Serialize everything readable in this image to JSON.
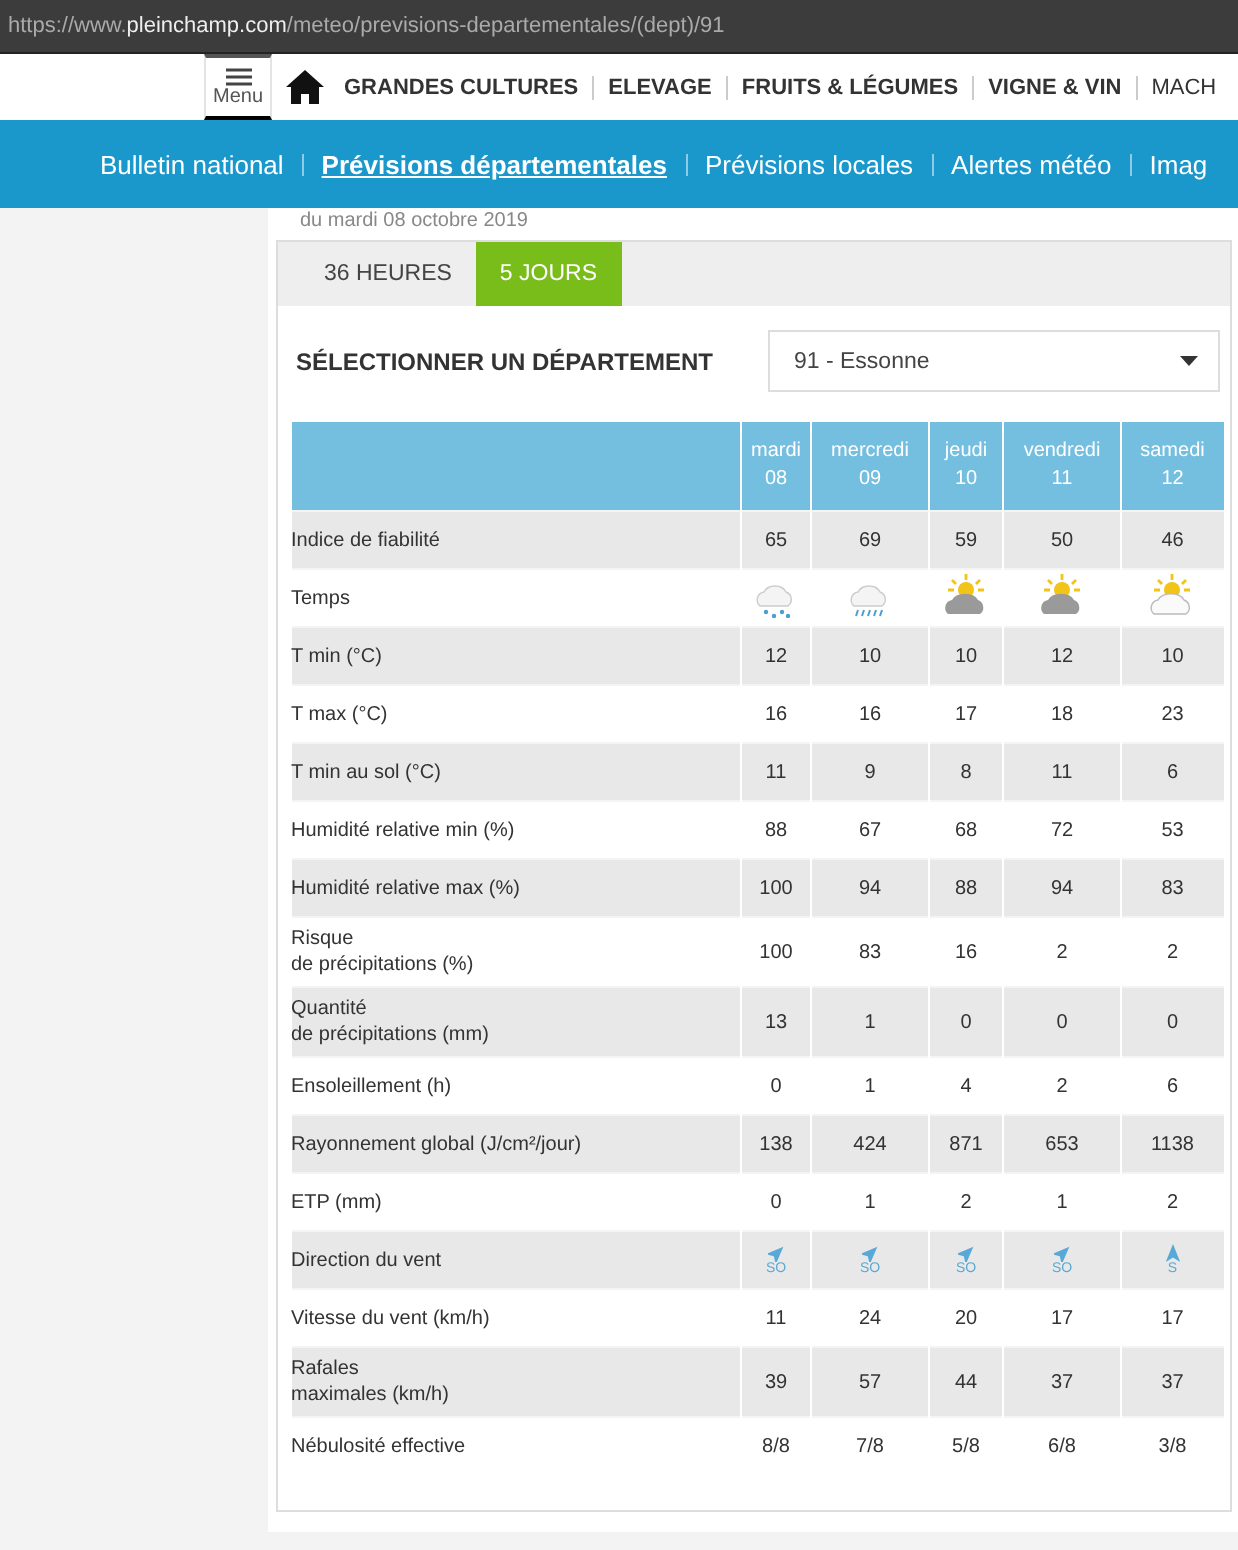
{
  "address_bar": {
    "prefix": "https://www.",
    "domain": "pleinchamp.com",
    "path": "/meteo/previsions-departementales/(dept)/91"
  },
  "menu_button": {
    "label": "Menu"
  },
  "main_nav": [
    {
      "label": "GRANDES CULTURES"
    },
    {
      "label": "ELEVAGE"
    },
    {
      "label": "FRUITS & LÉGUMES"
    },
    {
      "label": "VIGNE & VIN"
    },
    {
      "label": "MACH"
    }
  ],
  "sub_nav": [
    {
      "label": "Bulletin national",
      "selected": false
    },
    {
      "label": "Prévisions départementales",
      "selected": true
    },
    {
      "label": "Prévisions locales",
      "selected": false
    },
    {
      "label": "Alertes météo",
      "selected": false
    },
    {
      "label": "Imag",
      "selected": false
    }
  ],
  "date_line": "du mardi 08 octobre 2019",
  "tabs": [
    {
      "label": "36 HEURES",
      "selected": false
    },
    {
      "label": "5 JOURS",
      "selected": true
    }
  ],
  "department": {
    "label": "SÉLECTIONNER UN DÉPARTEMENT",
    "value": "91 - Essonne"
  },
  "table": {
    "columns": [
      {
        "day": "mardi",
        "date": "08"
      },
      {
        "day": "mercredi",
        "date": "09"
      },
      {
        "day": "jeudi",
        "date": "10"
      },
      {
        "day": "vendredi",
        "date": "11"
      },
      {
        "day": "samedi",
        "date": "12"
      }
    ],
    "rows": [
      {
        "kind": "text",
        "label": "Indice de fiabilité",
        "values": [
          "65",
          "69",
          "59",
          "50",
          "46"
        ]
      },
      {
        "kind": "weather",
        "label": "Temps",
        "values": [
          {
            "kind": "rain"
          },
          {
            "kind": "showers"
          },
          {
            "kind": "sun-dark-cloud"
          },
          {
            "kind": "sun-dark-cloud"
          },
          {
            "kind": "sun-light-cloud"
          }
        ]
      },
      {
        "kind": "text",
        "label": "T min (°C)",
        "values": [
          "12",
          "10",
          "10",
          "12",
          "10"
        ]
      },
      {
        "kind": "text",
        "label": "T max (°C)",
        "values": [
          "16",
          "16",
          "17",
          "18",
          "23"
        ]
      },
      {
        "kind": "text",
        "label": "T min au sol (°C)",
        "values": [
          "11",
          "9",
          "8",
          "11",
          "6"
        ]
      },
      {
        "kind": "text",
        "label": "Humidité relative min (%)",
        "values": [
          "88",
          "67",
          "68",
          "72",
          "53"
        ]
      },
      {
        "kind": "text",
        "label": "Humidité relative max (%)",
        "values": [
          "100",
          "94",
          "88",
          "94",
          "83"
        ]
      },
      {
        "kind": "text",
        "label": "Risque\nde précipitations (%)",
        "values": [
          "100",
          "83",
          "16",
          "2",
          "2"
        ]
      },
      {
        "kind": "text",
        "label": "Quantité\nde précipitations (mm)",
        "values": [
          "13",
          "1",
          "0",
          "0",
          "0"
        ]
      },
      {
        "kind": "text",
        "label": "Ensoleillement (h)",
        "values": [
          "0",
          "1",
          "4",
          "2",
          "6"
        ]
      },
      {
        "kind": "text",
        "label": "Rayonnement global (J/cm²/jour)",
        "values": [
          "138",
          "424",
          "871",
          "653",
          "1138"
        ]
      },
      {
        "kind": "text",
        "label": "ETP (mm)",
        "values": [
          "0",
          "1",
          "2",
          "1",
          "2"
        ]
      },
      {
        "kind": "wind",
        "label": "Direction du vent",
        "values": [
          {
            "kind": "northeast",
            "text": "SO"
          },
          {
            "kind": "northeast",
            "text": "SO"
          },
          {
            "kind": "northeast",
            "text": "SO"
          },
          {
            "kind": "northeast",
            "text": "SO"
          },
          {
            "kind": "north",
            "text": "S"
          }
        ]
      },
      {
        "kind": "text",
        "label": "Vitesse du vent (km/h)",
        "values": [
          "11",
          "24",
          "20",
          "17",
          "17"
        ]
      },
      {
        "kind": "text",
        "label": "Rafales\nmaximales (km/h)",
        "values": [
          "39",
          "57",
          "44",
          "37",
          "37"
        ]
      },
      {
        "kind": "text",
        "label": "Nébulosité effective",
        "values": [
          "8/8",
          "7/8",
          "5/8",
          "6/8",
          "3/8"
        ]
      }
    ]
  }
}
